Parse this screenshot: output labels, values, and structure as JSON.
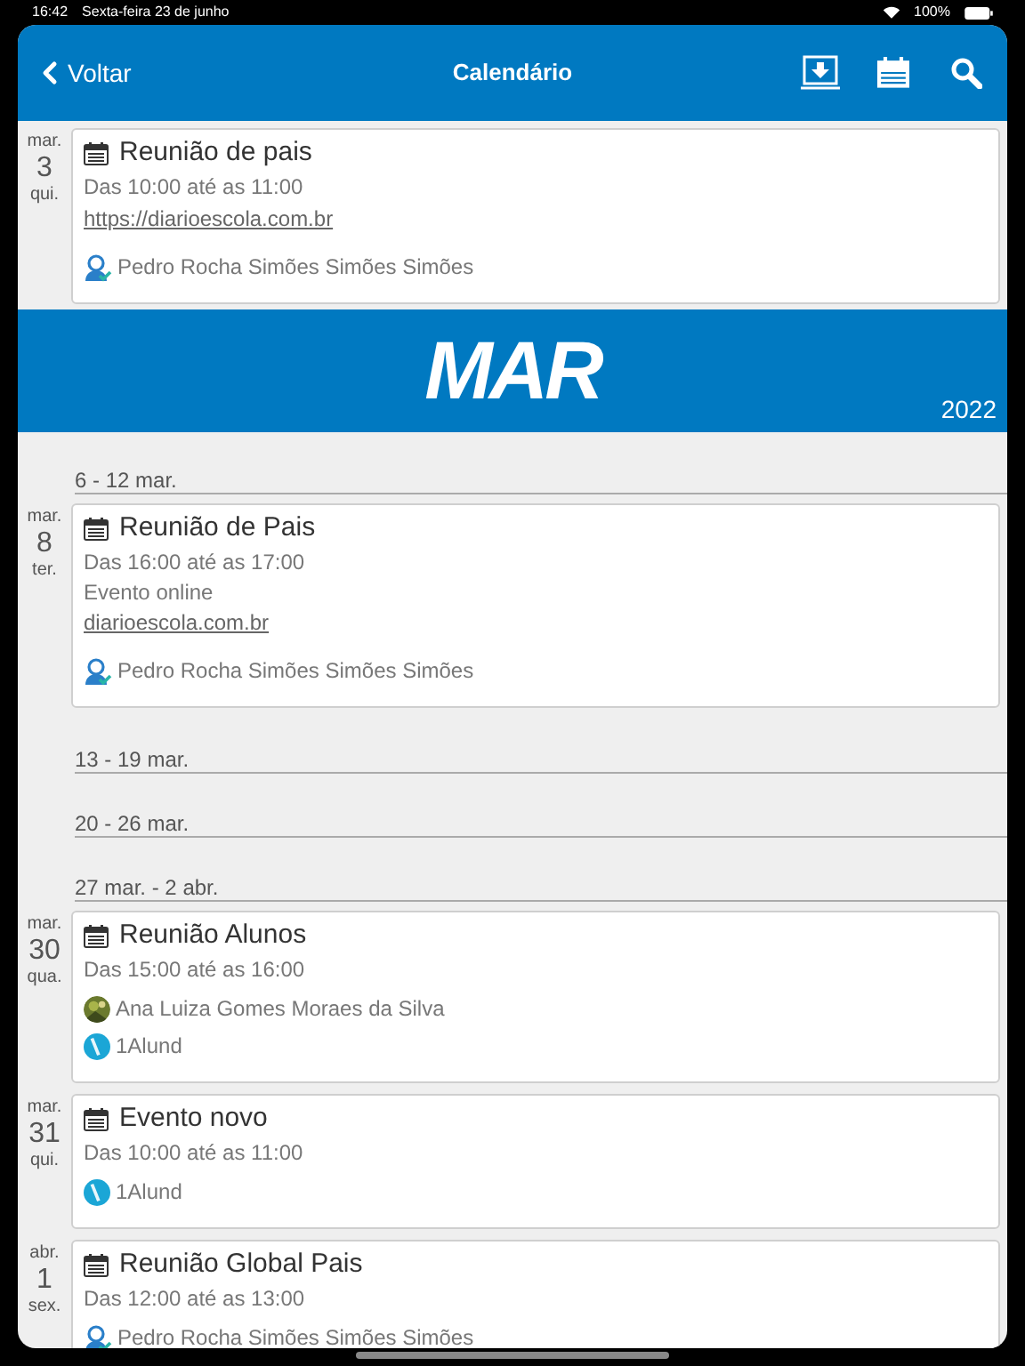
{
  "status_bar": {
    "time": "16:42",
    "date": "Sexta-feira 23 de junho",
    "battery": "100%"
  },
  "header": {
    "back": "Voltar",
    "title": "Calendário"
  },
  "sections": [
    {
      "kind": "day",
      "month": "mar.",
      "day": "3",
      "weekday": "qui.",
      "events": [
        {
          "title": "Reunião de pais",
          "time": "Das 10:00 até as 11:00",
          "link": "https://diarioescola.com.br",
          "participants": [
            {
              "kind": "teacher",
              "name": "Pedro Rocha Simões Simões Simões"
            }
          ]
        }
      ]
    },
    {
      "kind": "month",
      "month": "MAR",
      "year": "2022"
    },
    {
      "kind": "week",
      "label": "6 - 12 mar."
    },
    {
      "kind": "day",
      "month": "mar.",
      "day": "8",
      "weekday": "ter.",
      "events": [
        {
          "title": "Reunião de Pais",
          "time": "Das 16:00 até as 17:00",
          "note": "Evento online",
          "link": "diarioescola.com.br",
          "participants": [
            {
              "kind": "teacher",
              "name": "Pedro Rocha Simões Simões Simões"
            }
          ]
        }
      ]
    },
    {
      "kind": "week",
      "label": "13 - 19 mar."
    },
    {
      "kind": "week",
      "label": "20 - 26 mar."
    },
    {
      "kind": "week",
      "label": "27 mar. - 2 abr."
    },
    {
      "kind": "day",
      "month": "mar.",
      "day": "30",
      "weekday": "qua.",
      "events": [
        {
          "title": "Reunião Alunos",
          "time": "Das 15:00 até as 16:00",
          "participants": [
            {
              "name": "Ana Luiza Gomes Moraes da Silva"
            },
            {
              "kind": "group",
              "name": "1Alund"
            }
          ]
        }
      ]
    },
    {
      "kind": "day",
      "month": "mar.",
      "day": "31",
      "weekday": "qui.",
      "events": [
        {
          "title": "Evento novo",
          "time": "Das 10:00 até as 11:00",
          "participants": [
            {
              "kind": "group",
              "name": "1Alund"
            }
          ]
        }
      ]
    },
    {
      "kind": "day",
      "month": "abr.",
      "day": "1",
      "weekday": "sex.",
      "events": [
        {
          "title": "Reunião Global Pais",
          "time": "Das 12:00 até as 13:00",
          "participants": [
            {
              "kind": "teacher",
              "name": "Pedro Rocha Simões Simões Simões"
            }
          ]
        }
      ]
    }
  ]
}
